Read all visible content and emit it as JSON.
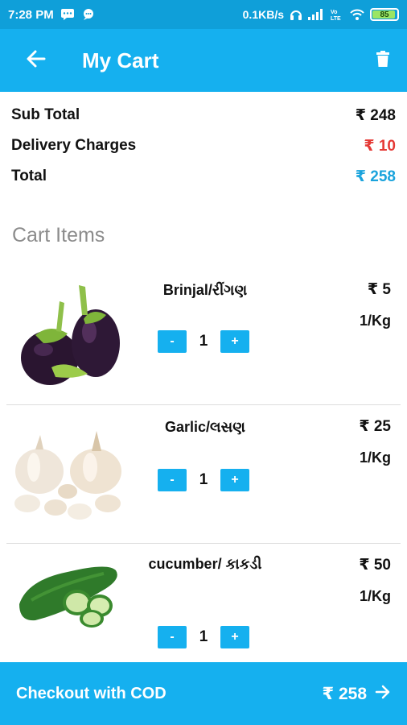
{
  "status_bar": {
    "time": "7:28 PM",
    "network_speed": "0.1KB/s",
    "battery_level": "85",
    "icons": [
      "message-icon",
      "chat-icon",
      "headset-icon",
      "signal-icon",
      "volte-icon",
      "wifi-icon",
      "battery-icon"
    ]
  },
  "app_bar": {
    "title": "My Cart",
    "back_icon": "arrow-left-icon",
    "delete_icon": "trash-icon"
  },
  "summary": {
    "sub_total_label": "Sub Total",
    "sub_total_value": "₹ 248",
    "delivery_label": "Delivery Charges",
    "delivery_value": "₹ 10",
    "total_label": "Total",
    "total_value": "₹ 258"
  },
  "section_title": "Cart Items",
  "items": [
    {
      "name": "Brinjal/રીંગણ",
      "price": "₹ 5",
      "unit": "1/Kg",
      "qty": "1",
      "minus": "-",
      "plus": "+"
    },
    {
      "name": "Garlic/લસણ",
      "price": "₹ 25",
      "unit": "1/Kg",
      "qty": "1",
      "minus": "-",
      "plus": "+"
    },
    {
      "name": "cucumber/ કાકડી",
      "price": "₹ 50",
      "unit": "1/Kg",
      "qty": "1",
      "minus": "-",
      "plus": "+"
    }
  ],
  "checkout": {
    "label": "Checkout with COD",
    "amount": "₹ 258",
    "arrow_icon": "arrow-right-icon"
  },
  "colors": {
    "primary": "#15b0ef",
    "status_bar": "#0f9fd9",
    "delivery_red": "#e53935",
    "total_blue": "#1aa3dc",
    "section_gray": "#8c8c8c"
  }
}
